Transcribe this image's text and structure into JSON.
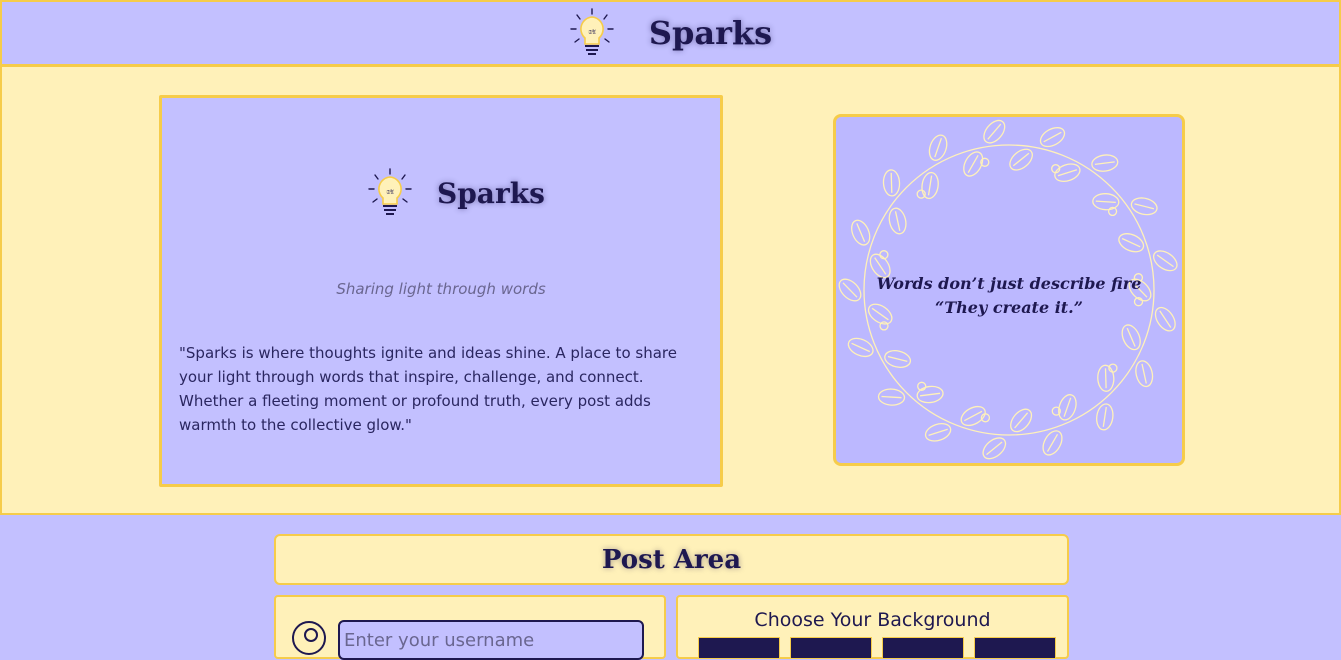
{
  "header": {
    "brand": "Sparks",
    "logo_icon": "lightbulb-icon",
    "logo_text": "𝔖𝔄"
  },
  "intro": {
    "brand": "Sparks",
    "tagline": "Sharing light through words",
    "about": "\"Sparks is where thoughts ignite and ideas shine. A place to share your light through words that inspire, challenge, and connect. Whether a fleeting moment or profound truth, every post adds warmth to the collective glow.\""
  },
  "quote_card": {
    "line1": "Words don’t just describe fire",
    "line2": "“They create it.”"
  },
  "post_area": {
    "title": "Post Area",
    "username_placeholder": "Enter your username",
    "background_title": "Choose Your Background"
  },
  "colors": {
    "accent": "#f6cc4a",
    "lavender": "#c3c0ff",
    "cream": "#fff1b9",
    "ink": "#1e1850"
  }
}
